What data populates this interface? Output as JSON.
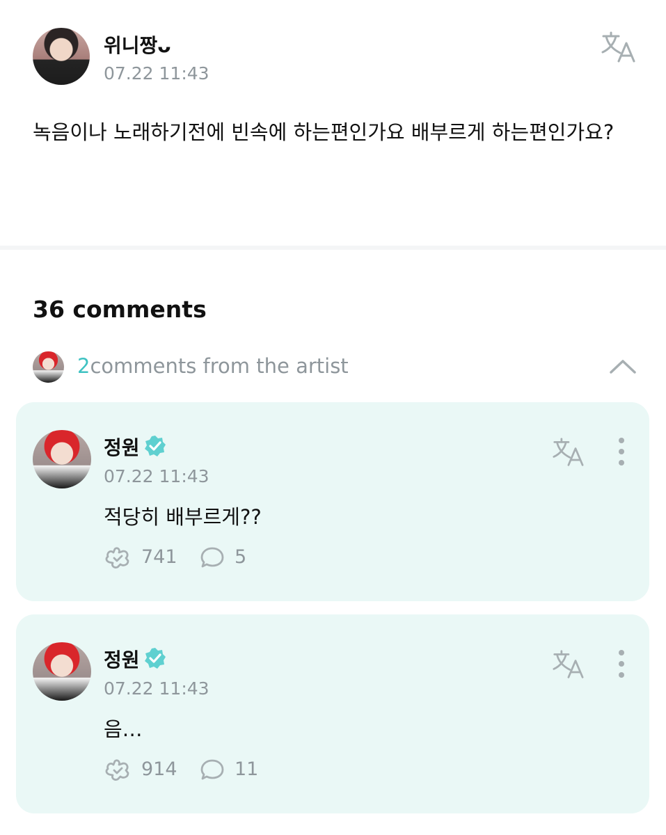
{
  "post": {
    "author": "위니짱ᴗ",
    "time": "07.22 11:43",
    "body": "녹음이나 노래하기전에 빈속에 하는편인가요 배부르게 하는편인가요?",
    "translate_icon": "translate-icon"
  },
  "comments_header": {
    "title": "36 comments",
    "artist_count": "2",
    "artist_label": "comments from the artist",
    "collapse_icon": "chevron-up-icon"
  },
  "artist_comments": [
    {
      "name": "정원",
      "verified": true,
      "time": "07.22 11:43",
      "text": "적당히 배부르게??",
      "likes": "741",
      "replies": "5"
    },
    {
      "name": "정원",
      "verified": true,
      "time": "07.22 11:43",
      "text": "음…",
      "likes": "914",
      "replies": "11"
    }
  ],
  "colors": {
    "accent": "#3fc2c2",
    "card_background": "#eaf8f6",
    "muted_text": "#8e969b",
    "verified": "#5fd0d0"
  }
}
